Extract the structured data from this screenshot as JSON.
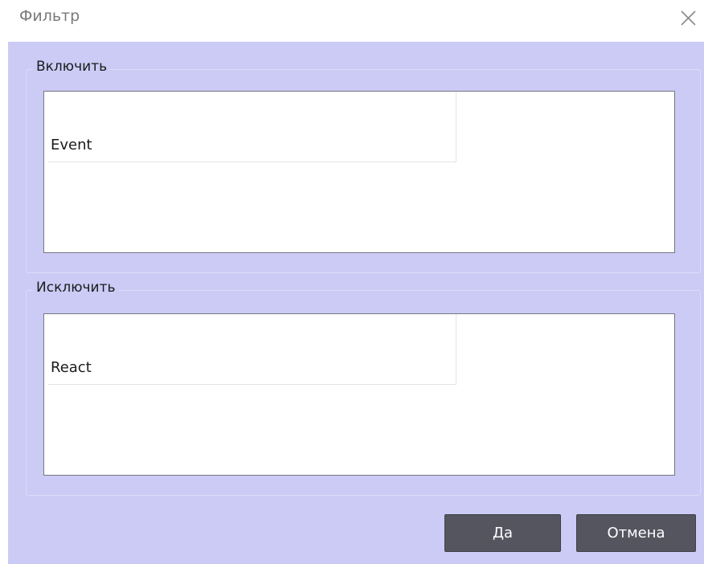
{
  "window": {
    "title": "Фильтр",
    "close_icon": "close-icon"
  },
  "include": {
    "label": "Включить",
    "items": [
      "Event"
    ]
  },
  "exclude": {
    "label": "Исключить",
    "items": [
      "React"
    ]
  },
  "buttons": {
    "ok_label": "Да",
    "cancel_label": "Отмена"
  },
  "colors": {
    "client_background": "#cbcbf6",
    "button_background": "#55555f",
    "button_text": "#ffffff",
    "title_text": "#7a7a7a"
  }
}
